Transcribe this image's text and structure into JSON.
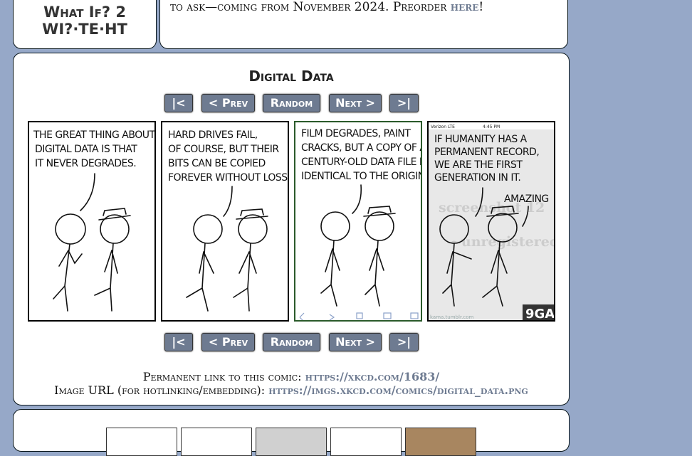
{
  "book": {
    "title_line1": "What If? 2",
    "title_line2": "WI?·TE·HT"
  },
  "news": {
    "text": "to ask—coming from November 2024. Preorder ",
    "link": "here",
    "tail": "!"
  },
  "comic": {
    "title": "Digital Data",
    "nav": {
      "first": "|<",
      "prev": "< Prev",
      "random": "Random",
      "next": "Next >",
      "last": ">|"
    },
    "panels": [
      {
        "lines": [
          "THE GREAT THING ABOUT",
          "DIGITAL DATA IS THAT",
          "IT NEVER DEGRADES."
        ]
      },
      {
        "lines": [
          "HARD DRIVES FAIL,",
          "OF COURSE, BUT THEIR",
          "BITS CAN BE COPIED",
          "FOREVER WITHOUT LOSS."
        ]
      },
      {
        "lines": [
          "FILM DEGRADES, PAINT",
          "CRACKS, BUT A COPY OF A",
          "CENTURY-OLD DATA FILE IS",
          "IDENTICAL TO THE ORIGINAL."
        ]
      },
      {
        "lines": [
          "IF HUMANITY HAS A",
          "PERMANENT RECORD,",
          "WE ARE THE FIRST",
          "GENERATION IN IT."
        ],
        "status_carrier": "Verizon LTE",
        "status_time": "4:45 PM",
        "extra": "AMAZING",
        "watermark": "screenshot 12",
        "watermark2": "~unregistered~",
        "site": "9GAG",
        "footer": "kama.tumblr.com"
      }
    ],
    "permalink_label": "Permanent link to this comic: ",
    "permalink_url": "https://xkcd.com/1683/",
    "imgurl_label": "Image URL (for hotlinking/embedding): ",
    "imgurl_url": "https://imgs.xkcd.com/comics/digital_data.png"
  },
  "colors": {
    "background": "#96a8c8",
    "button": "#6e7b91",
    "link": "#6e7b91"
  }
}
